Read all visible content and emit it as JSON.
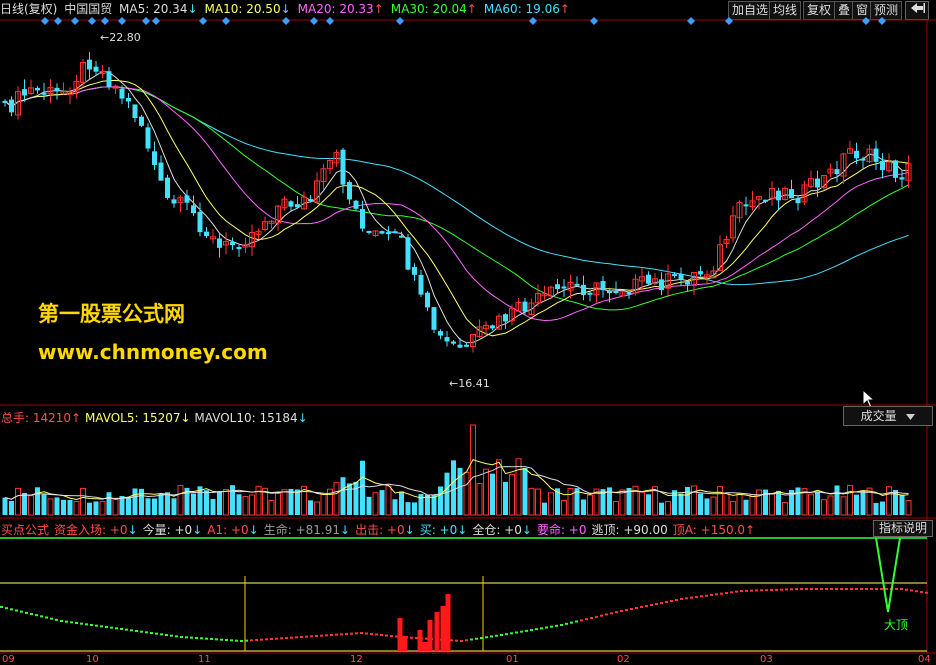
{
  "header": {
    "period": "日线(复权)",
    "stock_name": "中国国贸",
    "ma": [
      {
        "label": "MA5: 20.34",
        "arrow": "↓",
        "color": "#dddddd"
      },
      {
        "label": "MA10: 20.50",
        "arrow": "↓",
        "color": "#ffff66"
      },
      {
        "label": "MA20: 20.33",
        "arrow": "↑",
        "color": "#ff66ff"
      },
      {
        "label": "MA30: 20.04",
        "arrow": "↑",
        "color": "#33ff33"
      },
      {
        "label": "MA60: 19.06",
        "arrow": "↑",
        "color": "#44e0ff"
      }
    ],
    "toolbar": [
      "加自选",
      "均线",
      "复权",
      "叠",
      "窗",
      "预测"
    ],
    "nav_icon": "arrow-left-icon"
  },
  "price_chart": {
    "high_label": "22.80",
    "low_label": "16.41"
  },
  "watermark": {
    "line1": "第一股票公式网",
    "line2": "www.chnmoney.com"
  },
  "volume_panel": {
    "total_label": "总手: 14210",
    "total_arrow": "↑",
    "mavol5_label": "MAVOL5: 15207",
    "mavol5_arrow": "↓",
    "mavol10_label": "MAVOL10: 15184",
    "mavol10_arrow": "↓",
    "select_label": "成交量",
    "colors": {
      "up": "#ff3333",
      "down": "#44e0ff"
    }
  },
  "indicator_panel": {
    "items": [
      {
        "text": "买点公式",
        "color": "#ff4d4d"
      },
      {
        "text": "资金入场: +0",
        "arrow": "↓",
        "color": "#ff4d4d"
      },
      {
        "text": "今量: +0",
        "arrow": "↓",
        "color": "#dddddd"
      },
      {
        "text": "A1: +0",
        "arrow": "↓",
        "color": "#ff4d4d"
      },
      {
        "text": "生命: +81.91",
        "arrow": "↓",
        "color": "#999999"
      },
      {
        "text": "出击: +0",
        "arrow": "↓",
        "color": "#ff4d4d"
      },
      {
        "text": "买: +0",
        "arrow": "↓",
        "color": "#44e0ff"
      },
      {
        "text": "全仓: +0",
        "arrow": "↓",
        "color": "#dddddd"
      },
      {
        "text": "要命: +0",
        "arrow": "",
        "color": "#ff66ff"
      },
      {
        "text": "逃顶: +90.00",
        "arrow": "",
        "color": "#dddddd"
      },
      {
        "text": "顶A: +150.0",
        "arrow": "↑",
        "color": "#ff4d4d"
      }
    ],
    "help_button": "指标说明",
    "top_signal": "大顶"
  },
  "x_axis": [
    "09",
    "10",
    "11",
    "12",
    "01",
    "02",
    "03",
    "04"
  ]
}
